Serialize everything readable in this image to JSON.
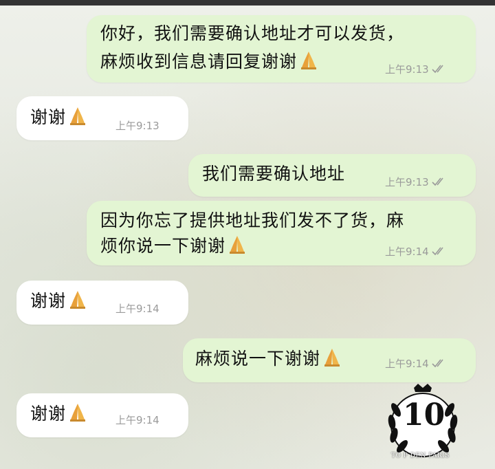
{
  "messages": [
    {
      "side": "out",
      "lines": [
        "你好，我们需要确认地址才可以发货，",
        "麻烦收到信息请回复谢谢"
      ],
      "emoji": "folded-hands",
      "time": "上午9:13",
      "read": true
    },
    {
      "side": "in",
      "lines": [
        "谢谢"
      ],
      "emoji": "folded-hands",
      "time": "上午9:13"
    },
    {
      "side": "out",
      "lines": [
        "我们需要确认地址"
      ],
      "emoji": "",
      "time": "上午9:13",
      "read": true
    },
    {
      "side": "out",
      "lines": [
        "因为你忘了提供地址我们发不了货，麻",
        "烦你说一下谢谢"
      ],
      "emoji": "folded-hands",
      "time": "上午9:14",
      "read": true
    },
    {
      "side": "in",
      "lines": [
        "谢谢"
      ],
      "emoji": "folded-hands",
      "time": "上午9:14"
    },
    {
      "side": "out",
      "lines": [
        "麻烦说一下谢谢"
      ],
      "emoji": "folded-hands",
      "time": "上午9:14",
      "read": true
    },
    {
      "side": "in",
      "lines": [
        "谢谢"
      ],
      "emoji": "folded-hands",
      "time": "上午9:14"
    }
  ],
  "watermark": {
    "number": "10",
    "caption": "TO P DEN PARIS"
  }
}
